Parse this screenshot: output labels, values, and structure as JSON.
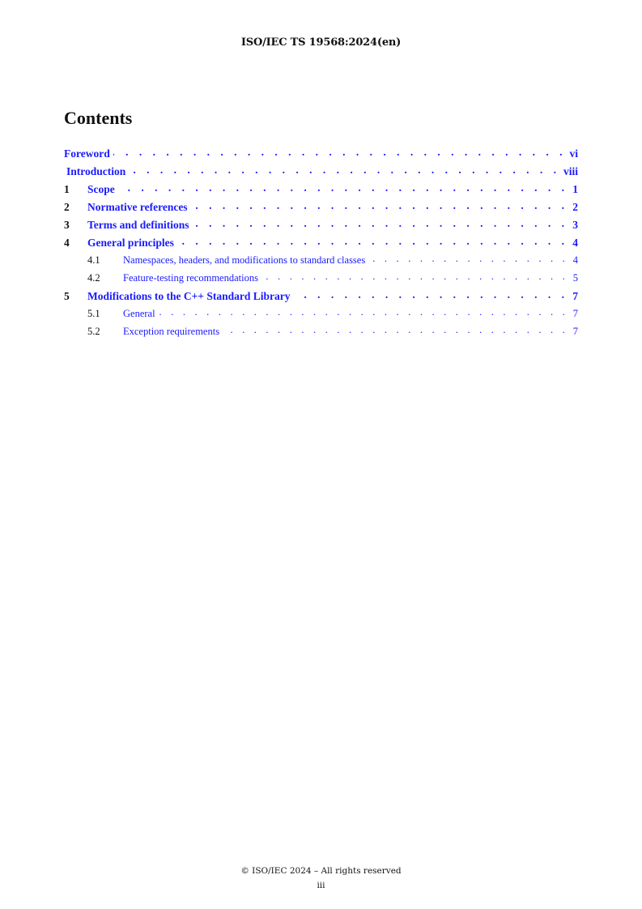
{
  "header": {
    "document_id": "ISO/IEC TS 19568:2024(en)"
  },
  "contents_title": "Contents",
  "toc": [
    {
      "number": "",
      "title": "Foreword",
      "page": "vi",
      "level": 0
    },
    {
      "number": "",
      "title": "Introduction",
      "page": "viii",
      "level": 0
    },
    {
      "number": "1",
      "title": "Scope",
      "page": "1",
      "level": 0
    },
    {
      "number": "2",
      "title": "Normative references",
      "page": "2",
      "level": 0
    },
    {
      "number": "3",
      "title": "Terms and definitions",
      "page": "3",
      "level": 0
    },
    {
      "number": "4",
      "title": "General principles",
      "page": "4",
      "level": 0
    },
    {
      "number": "4.1",
      "title": "Namespaces, headers, and modifications to standard classes",
      "page": "4",
      "level": 1
    },
    {
      "number": "4.2",
      "title": "Feature-testing recommendations",
      "page": "5",
      "level": 1
    },
    {
      "number": "5",
      "title": "Modifications to the C++ Standard Library",
      "page": "7",
      "level": 0
    },
    {
      "number": "5.1",
      "title": "General",
      "page": "7",
      "level": 1
    },
    {
      "number": "5.2",
      "title": "Exception requirements",
      "page": "7",
      "level": 1
    }
  ],
  "footer": {
    "copyright": "© ISO/IEC 2024 – All rights reserved",
    "page_number": "iii"
  },
  "colors": {
    "link": "#1a1aff",
    "text": "#111111"
  }
}
